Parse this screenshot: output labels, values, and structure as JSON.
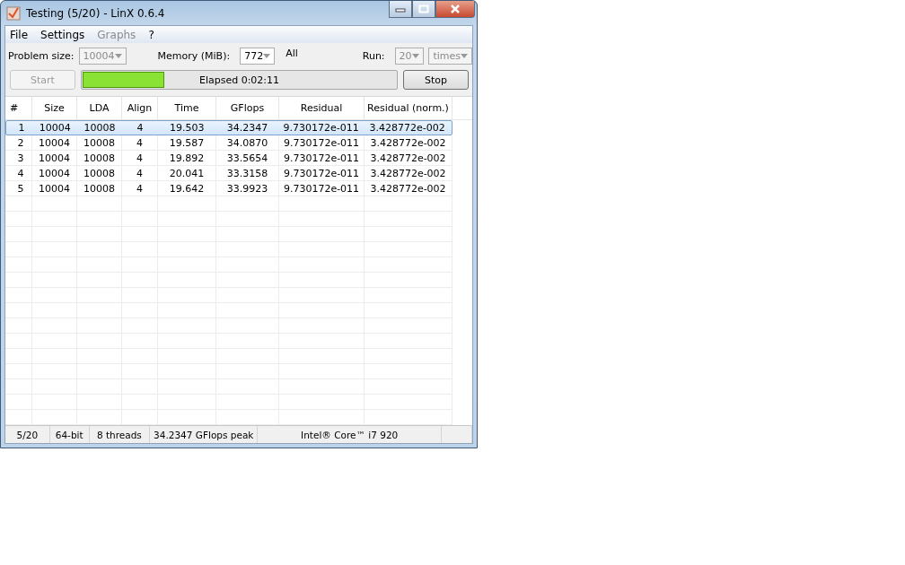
{
  "window": {
    "title": "Testing (5/20) - LinX 0.6.4"
  },
  "menu": [
    {
      "label": "File",
      "disabled": false
    },
    {
      "label": "Settings",
      "disabled": false
    },
    {
      "label": "Graphs",
      "disabled": true
    },
    {
      "label": "?",
      "disabled": false
    }
  ],
  "settings": {
    "problem_size": {
      "label": "Problem size:",
      "value": "10004",
      "disabled": true
    },
    "memory": {
      "label": "Memory (MiB):",
      "value": "772",
      "disabled": false
    },
    "memory_note": "All",
    "run": {
      "label": "Run:",
      "value": "20",
      "disabled": true
    },
    "run_unit": {
      "value": "times",
      "disabled": true
    }
  },
  "controls": {
    "start": {
      "label": "Start",
      "disabled": true
    },
    "progress": {
      "level": 0.26,
      "text": "Elapsed 0:02:11"
    },
    "stop": {
      "label": "Stop",
      "disabled": false
    }
  },
  "table": {
    "columns": [
      "#",
      "Size",
      "LDA",
      "Align",
      "Time",
      "GFlops",
      "Residual",
      "Residual (norm.)"
    ],
    "rows": [
      {
        "cells": [
          "1",
          "10004",
          "10008",
          "4",
          "19.503",
          "34.2347",
          "9.730172e-011",
          "3.428772e-002"
        ],
        "selected": true
      },
      {
        "cells": [
          "2",
          "10004",
          "10008",
          "4",
          "19.587",
          "34.0870",
          "9.730172e-011",
          "3.428772e-002"
        ],
        "selected": false
      },
      {
        "cells": [
          "3",
          "10004",
          "10008",
          "4",
          "19.892",
          "33.5654",
          "9.730172e-011",
          "3.428772e-002"
        ],
        "selected": false
      },
      {
        "cells": [
          "4",
          "10004",
          "10008",
          "4",
          "20.041",
          "33.3158",
          "9.730172e-011",
          "3.428772e-002"
        ],
        "selected": false
      },
      {
        "cells": [
          "5",
          "10004",
          "10008",
          "4",
          "19.642",
          "33.9923",
          "9.730172e-011",
          "3.428772e-002"
        ],
        "selected": false
      }
    ]
  },
  "status_bar": [
    "5/20",
    "64-bit",
    "8 threads",
    "34.2347 GFlops peak",
    "Intel® Core™ i7 920"
  ]
}
